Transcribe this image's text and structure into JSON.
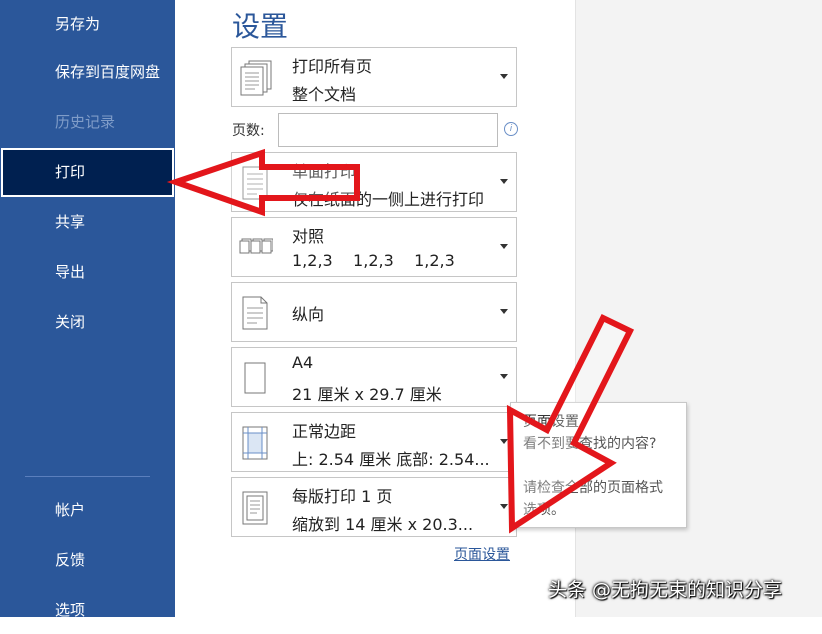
{
  "sidebar": {
    "items": [
      {
        "label": "另存为"
      },
      {
        "label": "保存到百度网盘"
      },
      {
        "label": "历史记录"
      },
      {
        "label": "打印"
      },
      {
        "label": "共享"
      },
      {
        "label": "导出"
      },
      {
        "label": "关闭"
      },
      {
        "label": "帐户"
      },
      {
        "label": "反馈"
      },
      {
        "label": "选项"
      }
    ]
  },
  "settings": {
    "title": "设置",
    "print_range": {
      "line1": "打印所有页",
      "line2": "整个文档"
    },
    "pages_label": "页数:",
    "pages_value": "",
    "sides": {
      "line1": "单面打印",
      "line2": "仅在纸面的一侧上进行打印"
    },
    "collate": {
      "line1": "对照",
      "line2": "1,2,3    1,2,3    1,2,3"
    },
    "orientation": {
      "line1": "纵向"
    },
    "paper": {
      "line1": "A4",
      "line2": "21 厘米 x 29.7 厘米"
    },
    "margins": {
      "line1": "正常边距",
      "line2": "上: 2.54 厘米 底部: 2.54..."
    },
    "scaling": {
      "line1": "每版打印 1 页",
      "line2": "缩放到 14 厘米 x 20.3..."
    },
    "page_setup_link": "页面设置"
  },
  "tooltip": {
    "title": "页面设置",
    "text1": "看不到要查找的内容?",
    "text2": "请检查全部的页面格式选项。"
  },
  "watermark": "头条 @无拘无束的知识分享",
  "colors": {
    "sidebar": "#2b579a",
    "selected": "#002050",
    "arrow": "#e3161b"
  }
}
